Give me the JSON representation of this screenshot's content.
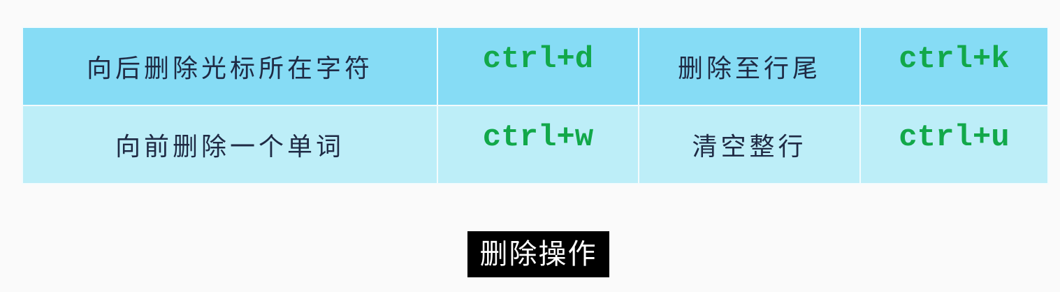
{
  "table": {
    "rows": [
      {
        "desc1": "向后删除光标所在字符",
        "key1": "ctrl+d",
        "desc2": "删除至行尾",
        "key2": "ctrl+k"
      },
      {
        "desc1": "向前删除一个单词",
        "key1": "ctrl+w",
        "desc2": "清空整行",
        "key2": "ctrl+u"
      }
    ]
  },
  "caption": "删除操作",
  "colors": {
    "header_row_bg": "#86dcf5",
    "second_row_bg": "#bdeef8",
    "key_text": "#12a84a",
    "desc_text": "#1f2a44",
    "caption_bg": "#000000",
    "caption_text": "#ffffff"
  }
}
